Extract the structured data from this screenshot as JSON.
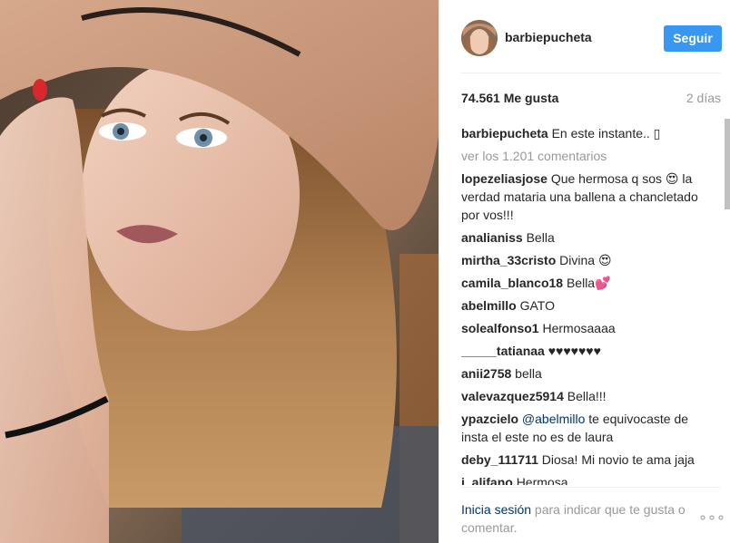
{
  "post": {
    "username": "barbiepucheta",
    "follow_label": "Seguir",
    "likes": "74.561 Me gusta",
    "time_ago": "2 días"
  },
  "caption": {
    "user": "barbiepucheta",
    "text": "En este instante.. ▯"
  },
  "view_all_comments": "ver los 1.201 comentarios",
  "comments": [
    {
      "user": "lopezeliasjose",
      "text": "Que hermosa q sos 😍 la verdad mataria una ballena a chancletado por vos!!!"
    },
    {
      "user": "analianiss",
      "text": "Bella"
    },
    {
      "user": "mirtha_33cristo",
      "text": "Divina 😍"
    },
    {
      "user": "camila_blanco18",
      "text": "Bella💕"
    },
    {
      "user": "abelmillo",
      "text": "GATO"
    },
    {
      "user": "solealfonso1",
      "text": "Hermosaaaa"
    },
    {
      "user": "_____tatianaa",
      "text": "♥♥♥♥♥♥♥"
    },
    {
      "user": "anii2758",
      "text": "bella"
    },
    {
      "user": "valevazquez5914",
      "text": "Bella!!!"
    },
    {
      "user": "ypazcielo",
      "mention": "@abelmillo",
      "text": "te equivocaste de insta el este no es de laura"
    },
    {
      "user": "deby_111711",
      "text": "Diosa! Mi novio te ama jaja"
    },
    {
      "user": "j_alifano",
      "text": "Hermosa"
    }
  ],
  "footer": {
    "login_link": "Inicia sesión",
    "login_rest": " para indicar que te gusta o comentar."
  },
  "icons": {
    "more": "more-options-icon",
    "avatar": "avatar"
  },
  "colors": {
    "accent": "#3897f0",
    "link": "#003569",
    "muted": "#999999"
  }
}
